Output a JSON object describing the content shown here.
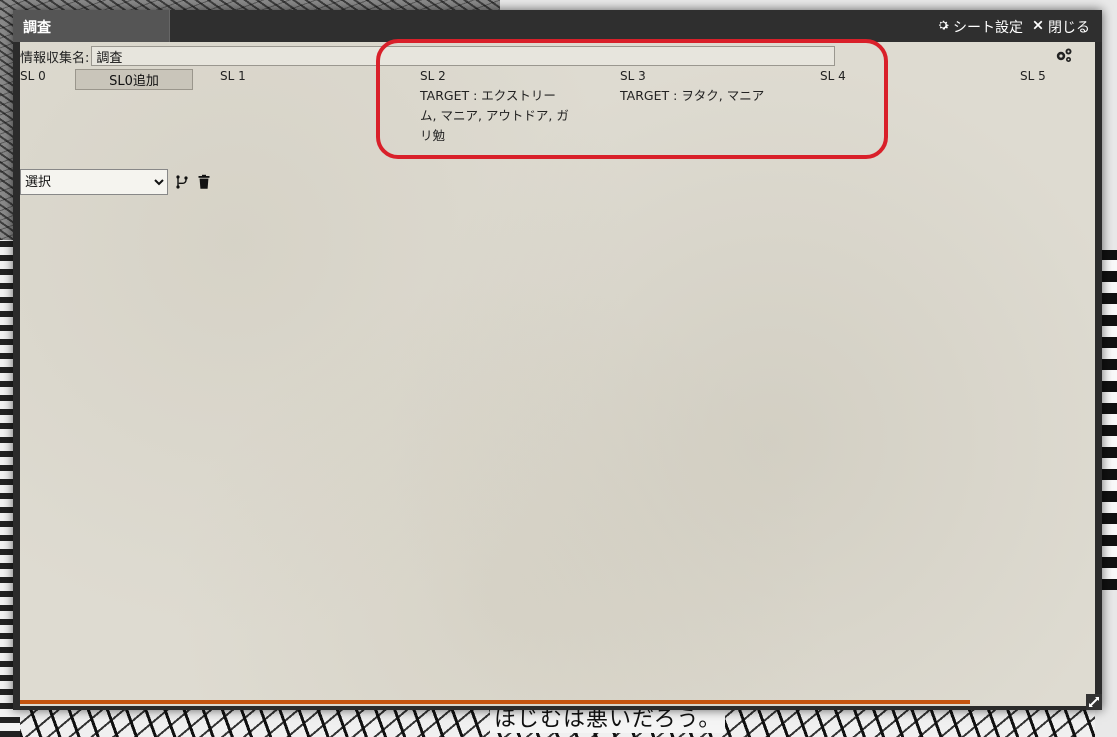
{
  "window": {
    "tab_title": "調査",
    "sheet_settings_label": "シート設定",
    "close_label": "閉じる",
    "settings_icon": "gear-icon",
    "close_icon": "x-icon"
  },
  "form": {
    "name_label": "情報収集名:",
    "name_value": "調査"
  },
  "sl_columns": [
    {
      "label": "SL 0"
    },
    {
      "label": "SL 1"
    },
    {
      "label": "SL 2",
      "target": "TARGET : エクストリーム, マニア, アウトドア, ガリ勉"
    },
    {
      "label": "SL 3",
      "target": "TARGET : ヲタク, マニア"
    },
    {
      "label": "SL 4"
    },
    {
      "label": "SL 5"
    }
  ],
  "add_button_label": "SL0追加",
  "selector": {
    "value": "選択",
    "branch_icon": "branch-icon",
    "delete_icon": "trash-icon"
  },
  "background": {
    "caption": "ほじむは悪いだろう。"
  },
  "colors": {
    "highlight": "#d9202a",
    "progress": "#c4540f",
    "titlebar": "#2f2f2f"
  }
}
